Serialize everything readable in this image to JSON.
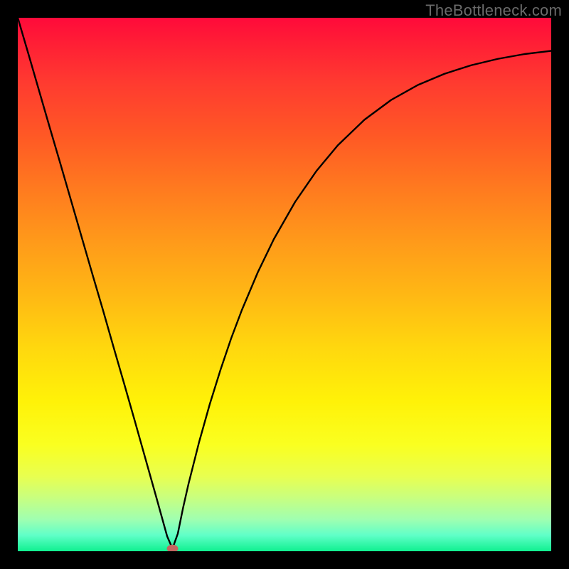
{
  "watermark": "TheBottleneck.com",
  "colors": {
    "background": "#000000",
    "gradient_top": "#ff0a3a",
    "gradient_bottom": "#10f090",
    "curve_stroke": "#000000",
    "marker_fill": "#c46560"
  },
  "chart_data": {
    "type": "line",
    "title": "",
    "xlabel": "",
    "ylabel": "",
    "xlim": [
      0,
      100
    ],
    "ylim": [
      0,
      100
    ],
    "x": [
      0,
      2,
      4,
      6,
      8,
      10,
      12,
      14,
      16,
      18,
      20,
      22,
      24,
      26,
      28,
      29,
      30,
      31,
      32,
      34,
      36,
      38,
      40,
      42,
      45,
      48,
      52,
      56,
      60,
      65,
      70,
      75,
      80,
      85,
      90,
      95,
      100
    ],
    "values": [
      100,
      93.2,
      86.3,
      79.4,
      72.6,
      65.7,
      58.8,
      51.9,
      45.1,
      38.1,
      31.2,
      24.2,
      17.1,
      10.0,
      2.8,
      0.5,
      3.3,
      8.2,
      12.6,
      20.5,
      27.6,
      34.0,
      39.9,
      45.2,
      52.3,
      58.5,
      65.5,
      71.3,
      76.1,
      80.9,
      84.6,
      87.4,
      89.5,
      91.1,
      92.3,
      93.2,
      93.8
    ],
    "marker": {
      "x": 29,
      "y": 0.5
    }
  }
}
